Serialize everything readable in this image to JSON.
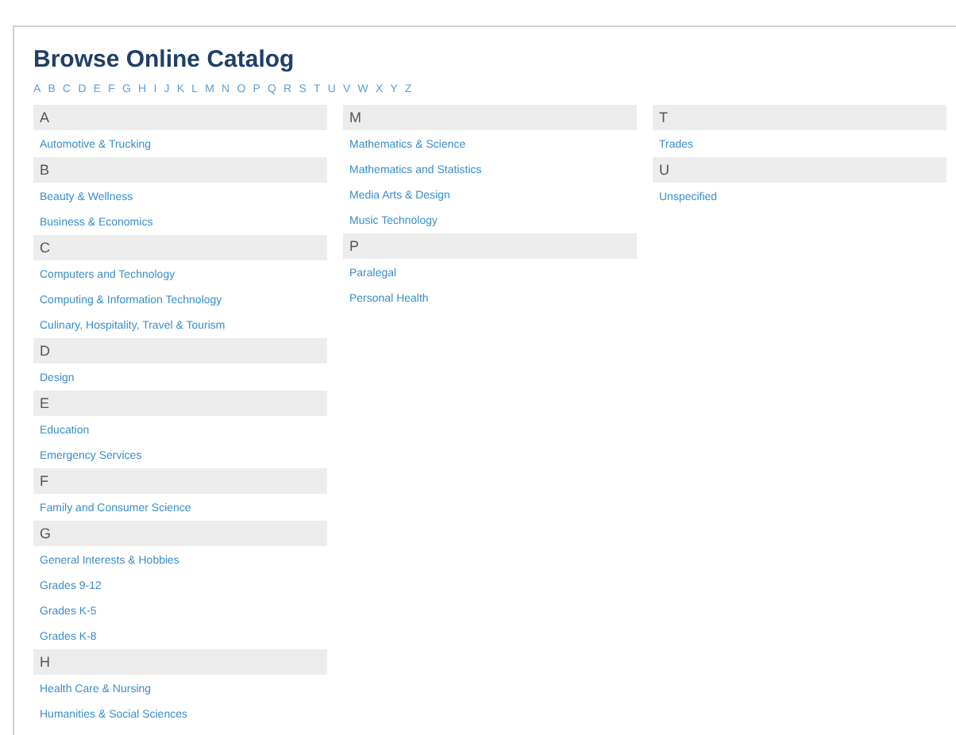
{
  "title": "Browse Online Catalog",
  "alphabet": [
    "A",
    "B",
    "C",
    "D",
    "E",
    "F",
    "G",
    "H",
    "I",
    "J",
    "K",
    "L",
    "M",
    "N",
    "O",
    "P",
    "Q",
    "R",
    "S",
    "T",
    "U",
    "V",
    "W",
    "X",
    "Y",
    "Z"
  ],
  "columns": [
    {
      "groups": [
        {
          "letter": "A",
          "links": [
            "Automotive & Trucking"
          ]
        },
        {
          "letter": "B",
          "links": [
            "Beauty & Wellness",
            "Business & Economics"
          ]
        },
        {
          "letter": "C",
          "links": [
            "Computers and Technology",
            "Computing & Information Technology",
            "Culinary, Hospitality, Travel & Tourism"
          ]
        },
        {
          "letter": "D",
          "links": [
            "Design"
          ]
        },
        {
          "letter": "E",
          "links": [
            "Education",
            "Emergency Services"
          ]
        },
        {
          "letter": "F",
          "links": [
            "Family and Consumer Science"
          ]
        },
        {
          "letter": "G",
          "links": [
            "General Interests & Hobbies",
            "Grades 9-12",
            "Grades K-5",
            "Grades K-8"
          ]
        },
        {
          "letter": "H",
          "links": [
            "Health Care & Nursing",
            "Humanities & Social Sciences"
          ]
        }
      ]
    },
    {
      "groups": [
        {
          "letter": "M",
          "links": [
            "Mathematics & Science",
            "Mathematics and Statistics",
            "Media Arts & Design",
            "Music Technology"
          ]
        },
        {
          "letter": "P",
          "links": [
            "Paralegal",
            "Personal Health"
          ]
        }
      ]
    },
    {
      "groups": [
        {
          "letter": "T",
          "links": [
            "Trades"
          ]
        },
        {
          "letter": "U",
          "links": [
            "Unspecified"
          ]
        }
      ]
    }
  ]
}
